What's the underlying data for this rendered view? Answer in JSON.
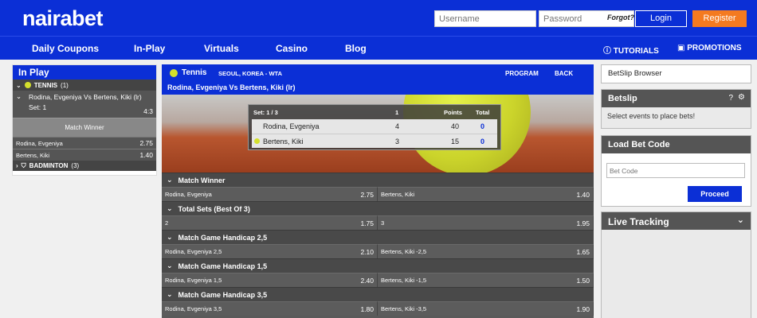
{
  "header": {
    "logo": "nairabet",
    "username_placeholder": "Username",
    "password_placeholder": "Password",
    "forgot": "Forgot?",
    "login": "Login",
    "register": "Register"
  },
  "nav": {
    "items": [
      "Daily Coupons",
      "In-Play",
      "Virtuals",
      "Casino",
      "Blog"
    ],
    "tutorials": "TUTORIALS",
    "promotions": "PROMOTIONS"
  },
  "left": {
    "title": "In Play",
    "sport1": "TENNIS",
    "sport1_count": "(1)",
    "match": "Rodina, Evgeniya Vs Bertens, Kiki (lr)",
    "set": "Set: 1",
    "score": "4:3",
    "market": "Match Winner",
    "rows": [
      {
        "name": "Rodina, Evgeniya",
        "odd": "2.75"
      },
      {
        "name": "Bertens, Kiki",
        "odd": "1.40"
      }
    ],
    "sport2": "BADMINTON",
    "sport2_count": "(3)"
  },
  "center": {
    "sport": "Tennis",
    "location": "SEOUL, KOREA - WTA",
    "program": "PROGRAM",
    "back": "BACK",
    "event": "Rodina, Evgeniya Vs Bertens, Kiki (lr)",
    "score": {
      "set_label": "Set: 1 / 3",
      "col_set": "1",
      "col_points": "Points",
      "col_total": "Total",
      "players": [
        {
          "name": "Rodina, Evgeniya",
          "set": "4",
          "points": "40",
          "total": "0"
        },
        {
          "name": "Bertens, Kiki",
          "set": "3",
          "points": "15",
          "total": "0"
        }
      ]
    },
    "markets": [
      {
        "title": "Match Winner",
        "sel": [
          {
            "name": "Rodina, Evgeniya",
            "odd": "2.75"
          },
          {
            "name": "Bertens, Kiki",
            "odd": "1.40"
          }
        ]
      },
      {
        "title": "Total Sets (Best Of 3)",
        "sel": [
          {
            "name": "2",
            "odd": "1.75"
          },
          {
            "name": "3",
            "odd": "1.95"
          }
        ]
      },
      {
        "title": "Match Game Handicap 2,5",
        "sel": [
          {
            "name": "Rodina, Evgeniya 2,5",
            "odd": "2.10"
          },
          {
            "name": "Bertens, Kiki -2,5",
            "odd": "1.65"
          }
        ]
      },
      {
        "title": "Match Game Handicap 1,5",
        "sel": [
          {
            "name": "Rodina, Evgeniya 1,5",
            "odd": "2.40"
          },
          {
            "name": "Bertens, Kiki -1,5",
            "odd": "1.50"
          }
        ]
      },
      {
        "title": "Match Game Handicap 3,5",
        "sel": [
          {
            "name": "Rodina, Evgeniya 3,5",
            "odd": "1.80"
          },
          {
            "name": "Bertens, Kiki -3,5",
            "odd": "1.90"
          }
        ]
      }
    ]
  },
  "right": {
    "betslip_browser": "BetSlip Browser",
    "betslip": "Betslip",
    "betslip_help": "?",
    "betslip_msg": "Select events to place bets!",
    "load_code": "Load Bet Code",
    "bet_code_placeholder": "Bet Code",
    "proceed": "Proceed",
    "live_tracking": "Live Tracking"
  },
  "colors": {
    "brand": "#0b2fd6",
    "accent": "#f47a20"
  }
}
